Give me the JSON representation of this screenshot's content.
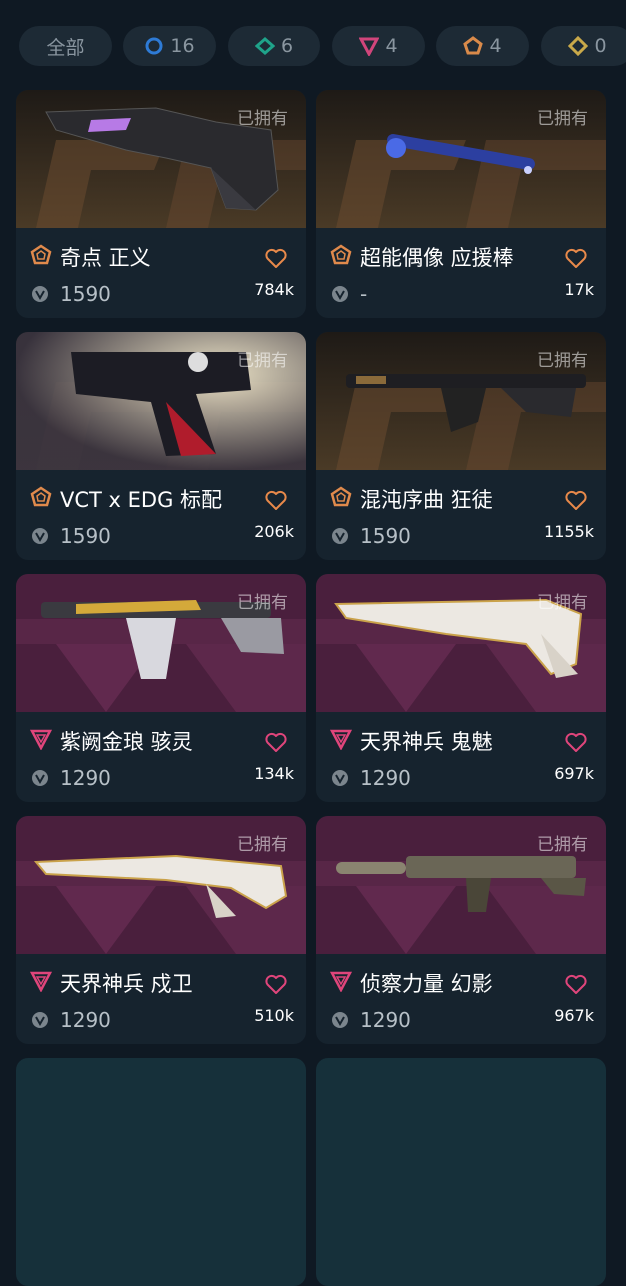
{
  "filters": [
    {
      "label": "全部",
      "count": "",
      "icon": "all-filter",
      "color": ""
    },
    {
      "label": "",
      "count": "16",
      "icon": "select-tier-icon",
      "color": "#2e7bd6"
    },
    {
      "label": "",
      "count": "6",
      "icon": "deluxe-tier-icon",
      "color": "#1fa38a"
    },
    {
      "label": "",
      "count": "4",
      "icon": "premium-tier-icon",
      "color": "#d1457b"
    },
    {
      "label": "",
      "count": "4",
      "icon": "ultra-tier-icon",
      "color": "#d98a4a"
    },
    {
      "label": "",
      "count": "0",
      "icon": "exclusive-tier-icon",
      "color": "#c9a94a"
    }
  ],
  "skins": [
    {
      "name": "奇点 正义",
      "price": "1590",
      "likes": "784k",
      "owned": "已拥有",
      "tier": "ultra",
      "tier_color": "#e08a4c",
      "heart_color": "#e8894a",
      "icon": "revolver-image"
    },
    {
      "name": "超能偶像 应援棒",
      "price": "-",
      "likes": "17k",
      "owned": "已拥有",
      "tier": "ultra",
      "tier_color": "#e08a4c",
      "heart_color": "#e8894a",
      "icon": "lightstick-image"
    },
    {
      "name": "VCT x EDG 标配",
      "price": "1590",
      "likes": "206k",
      "owned": "已拥有",
      "tier": "ultra",
      "tier_color": "#e08a4c",
      "heart_color": "#e8894a",
      "icon": "pistol-image"
    },
    {
      "name": "混沌序曲 狂徒",
      "price": "1590",
      "likes": "1155k",
      "owned": "已拥有",
      "tier": "ultra",
      "tier_color": "#e08a4c",
      "heart_color": "#e8894a",
      "icon": "rifle-image"
    },
    {
      "name": "紫阙金琅 骇灵",
      "price": "1290",
      "likes": "134k",
      "owned": "已拥有",
      "tier": "premium",
      "tier_color": "#e0457b",
      "heart_color": "#e0457b",
      "icon": "smg-image"
    },
    {
      "name": "天界神兵 鬼魅",
      "price": "1290",
      "likes": "697k",
      "owned": "已拥有",
      "tier": "premium",
      "tier_color": "#e0457b",
      "heart_color": "#e0457b",
      "icon": "ornate-pistol-image"
    },
    {
      "name": "天界神兵 戍卫",
      "price": "1290",
      "likes": "510k",
      "owned": "已拥有",
      "tier": "premium",
      "tier_color": "#e0457b",
      "heart_color": "#e0457b",
      "icon": "ornate-rifle-image"
    },
    {
      "name": "侦察力量 幻影",
      "price": "1290",
      "likes": "967k",
      "owned": "已拥有",
      "tier": "premium",
      "tier_color": "#e0457b",
      "heart_color": "#e0457b",
      "icon": "tactical-rifle-image"
    }
  ]
}
